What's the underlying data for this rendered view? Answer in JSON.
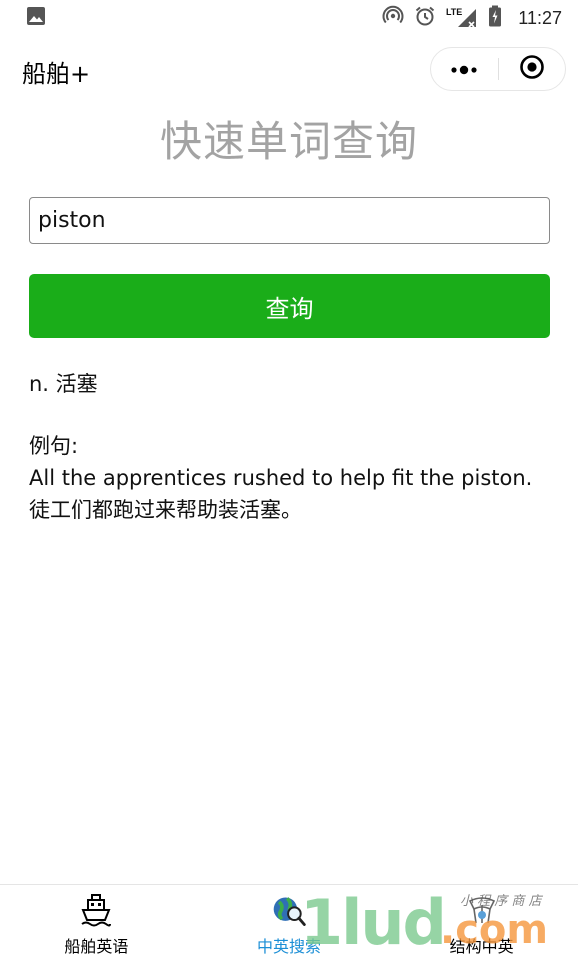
{
  "status_bar": {
    "time": "11:27",
    "network": "LTE",
    "icons": [
      "image-icon",
      "hotspot-icon",
      "alarm-icon",
      "signal-icon",
      "battery-icon"
    ]
  },
  "title_bar": {
    "app_title": "船舶+",
    "more_icon": "more-dots-icon",
    "close_icon": "target-circle-icon"
  },
  "page": {
    "heading": "快速单词查询",
    "search_value": "piston",
    "query_button": "查询",
    "result": {
      "definition": "n. 活塞",
      "example_label": "例句:",
      "example_en": "All the apprentices rushed to help fit the piston.",
      "example_zh": "徒工们都跑过来帮助装活塞。"
    }
  },
  "tab_bar": {
    "tabs": [
      {
        "label": "船舶英语",
        "icon": "ship-icon",
        "active": false
      },
      {
        "label": "中英搜索",
        "icon": "globe-search-icon",
        "active": true
      },
      {
        "label": "结构中英",
        "icon": "structure-icon",
        "active": false
      }
    ],
    "active_color": "#1c8fd6"
  },
  "colors": {
    "button": "#1aad19",
    "heading": "#a3a3a3"
  },
  "watermark": {
    "brand": "1lud",
    "suffix": ".com",
    "small": "小 程 序 商 店"
  }
}
